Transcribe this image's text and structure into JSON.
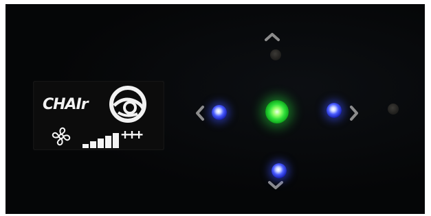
{
  "display": {
    "brand_text": "CHAIr",
    "plus_text": "+++",
    "fan_speed_level": 5,
    "fan_speed_max": 5
  },
  "leds": {
    "center": {
      "state": "on",
      "color": "#2fe03a"
    },
    "left": {
      "state": "on",
      "color": "#4a5cff"
    },
    "right": {
      "state": "on",
      "color": "#4a5cff"
    },
    "down": {
      "state": "on",
      "color": "#4a5cff"
    },
    "up": {
      "state": "off"
    },
    "far_right": {
      "state": "off"
    }
  },
  "icons": [
    "chevron-up-icon",
    "chevron-left-icon",
    "chevron-right-icon",
    "chevron-down-icon",
    "fan-icon",
    "brand-logo-icon"
  ]
}
